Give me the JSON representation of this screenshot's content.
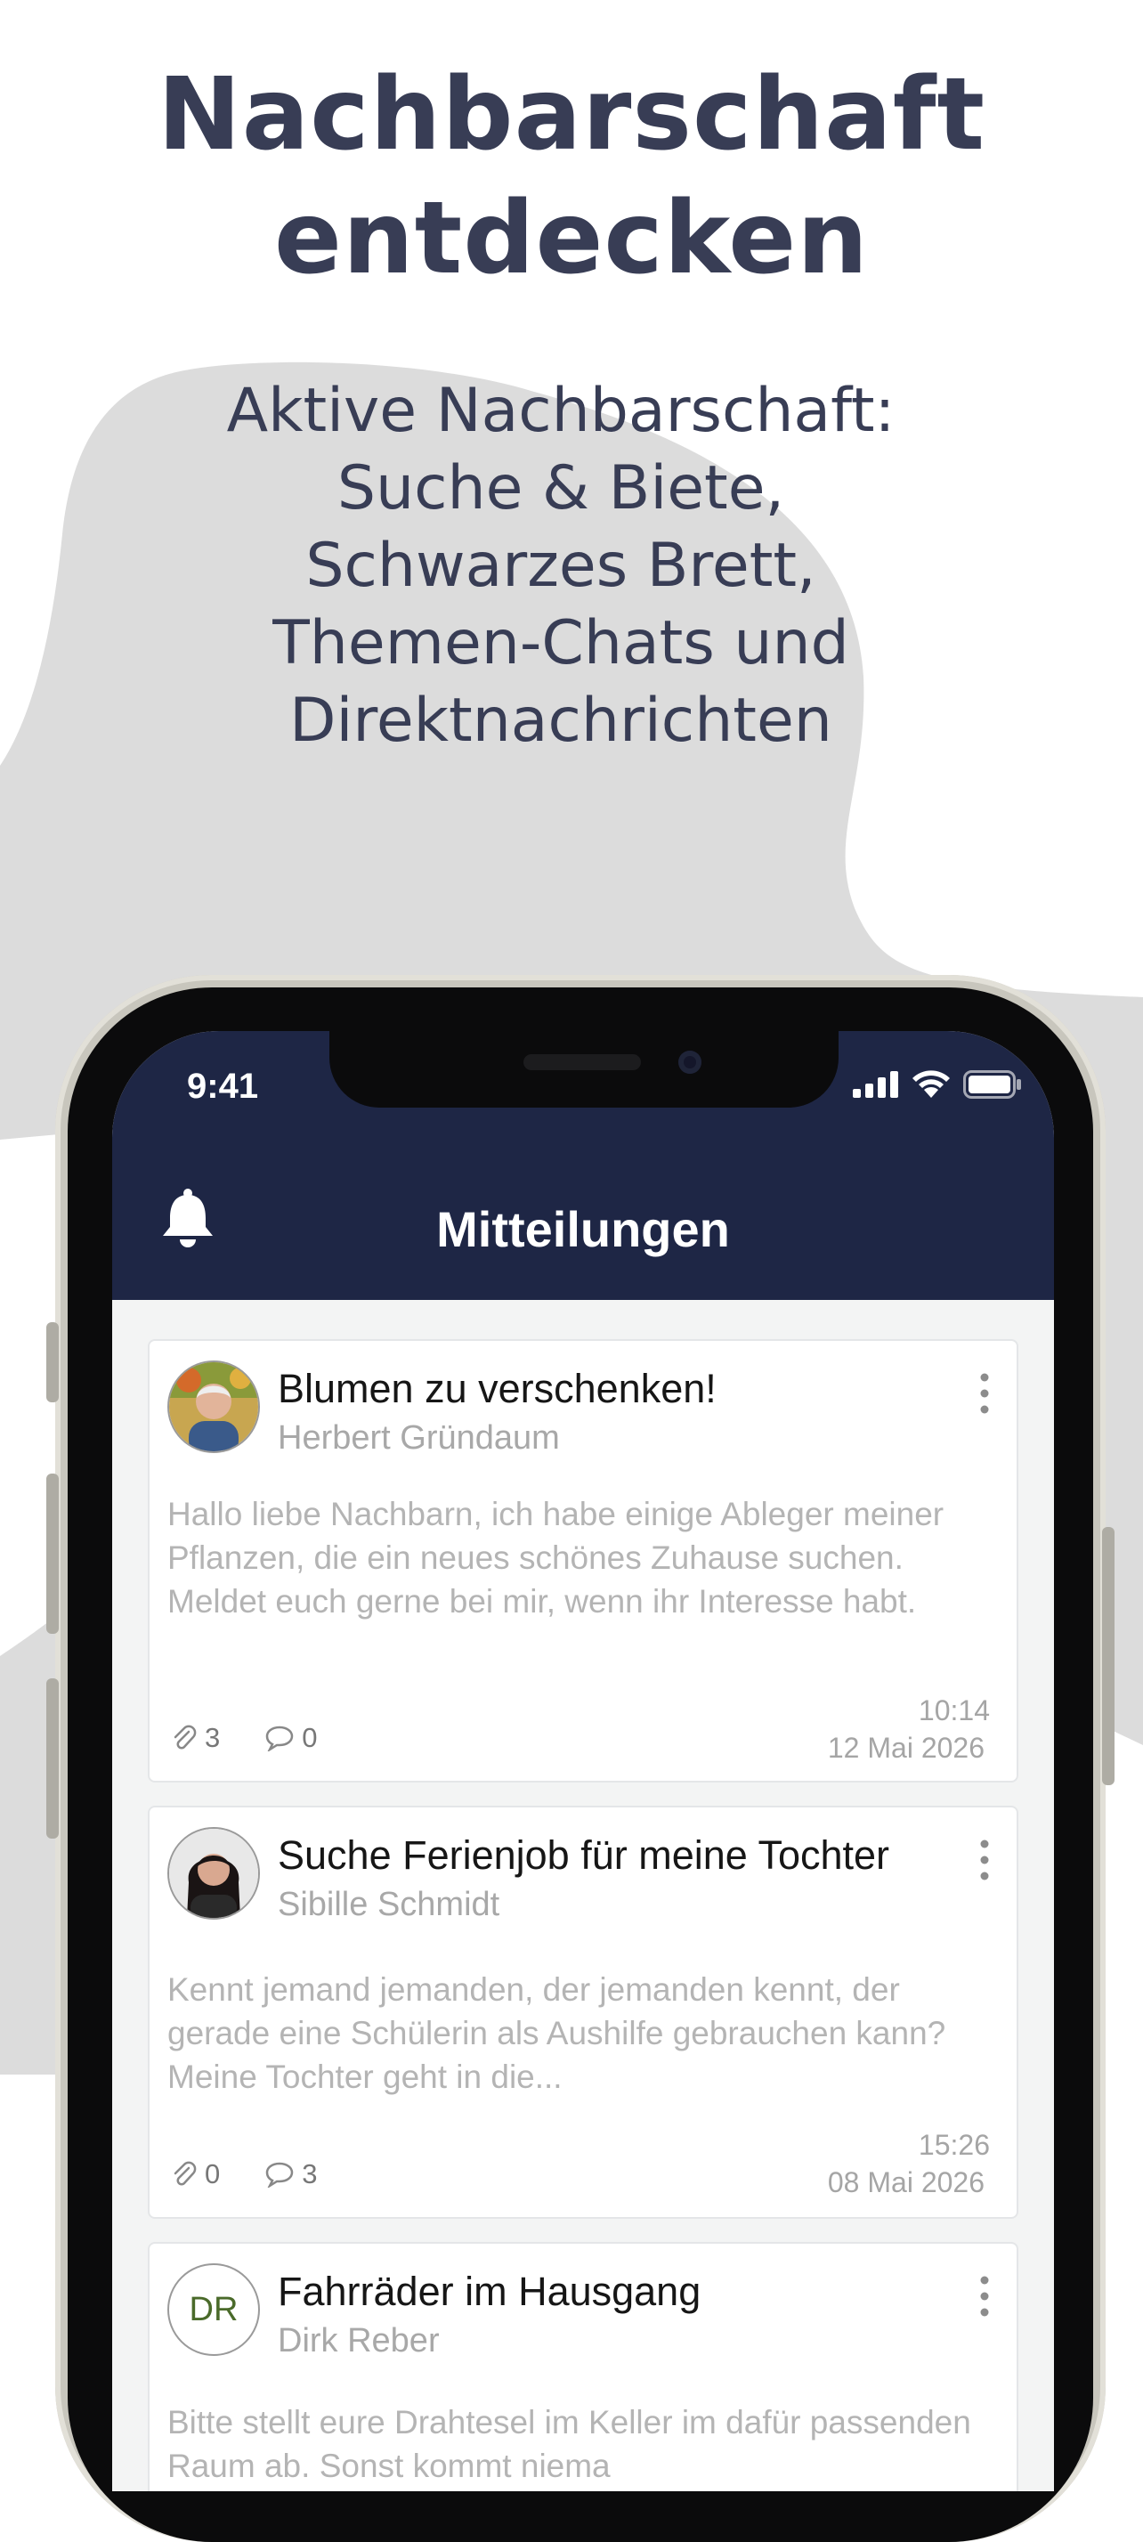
{
  "headline": [
    "Nachbarschaft",
    "entdecken"
  ],
  "subline": [
    "Aktive Nachbarschaft:",
    "Suche & Biete,",
    "Schwarzes Brett,",
    "Themen-Chats und",
    "Direktnachrichten"
  ],
  "status_bar": {
    "time": "9:41",
    "icons": [
      "signal-icon",
      "wifi-icon",
      "battery-icon"
    ]
  },
  "header": {
    "title": "Mitteilungen",
    "left_icon": "bell-icon"
  },
  "colors": {
    "topbar": "#1e2645",
    "headline": "#383d55",
    "blob": "#dcdcdc"
  },
  "posts": [
    {
      "title": "Blumen zu verschenken!",
      "author": "Herbert Gründaum",
      "body": "Hallo liebe Nachbarn, ich habe einige Ableger meiner Pflanzen, die ein neues schönes Zuhause suchen. Meldet euch gerne bei mir, wenn ihr Interesse habt.",
      "attachments": "3",
      "comments": "0",
      "time": "10:14",
      "date": "12 Mai 2026",
      "avatar": "photo"
    },
    {
      "title": "Suche Ferienjob für meine Tochter",
      "author": "Sibille Schmidt",
      "body": "Kennt jemand jemanden, der jemanden kennt, der gerade eine Schülerin als Aushilfe gebrauchen kann? Meine Tochter geht in die...",
      "attachments": "0",
      "comments": "3",
      "time": "15:26",
      "date": "08 Mai 2026",
      "avatar": "photo"
    },
    {
      "title": "Fahrräder im Hausgang",
      "author": "Dirk Reber",
      "initials": "DR",
      "body": "Bitte stellt eure Drahtesel im Keller im dafür passenden Raum ab. Sonst kommt niema",
      "avatar": "initials"
    }
  ]
}
